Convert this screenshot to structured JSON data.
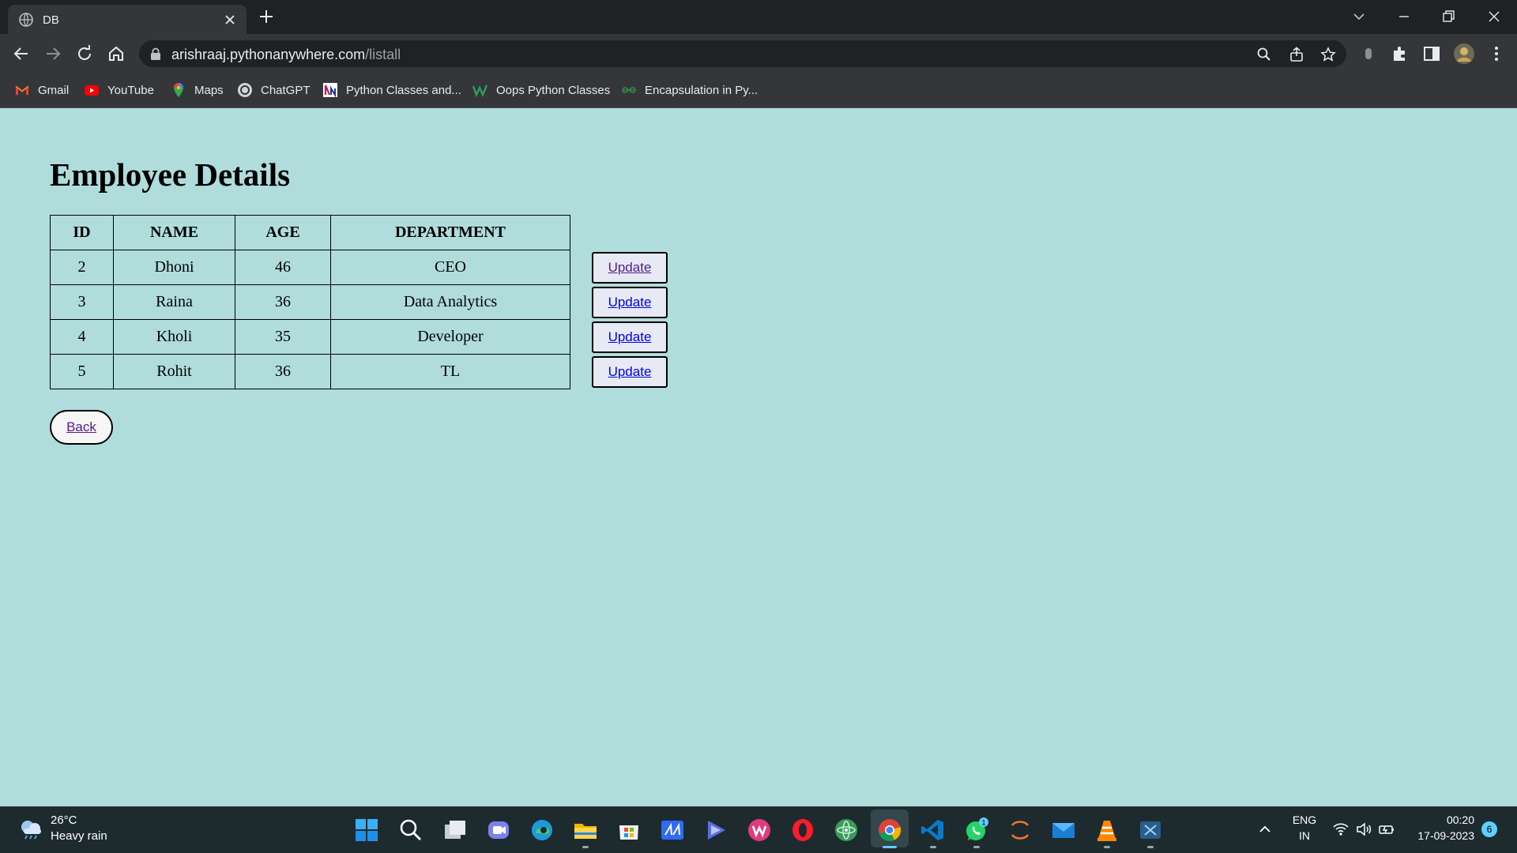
{
  "browser": {
    "tab_title": "DB",
    "url_host": "arishraaj.pythonanywhere.com",
    "url_path": "/listall",
    "bookmarks": [
      {
        "label": "Gmail"
      },
      {
        "label": "YouTube"
      },
      {
        "label": "Maps"
      },
      {
        "label": "ChatGPT"
      },
      {
        "label": "Python Classes and..."
      },
      {
        "label": "Oops Python Classes"
      },
      {
        "label": "Encapsulation in Py..."
      }
    ]
  },
  "page": {
    "title": "Employee Details",
    "table": {
      "headers": [
        "ID",
        "NAME",
        "AGE",
        "DEPARTMENT"
      ],
      "rows": [
        [
          "2",
          "Dhoni",
          "46",
          "CEO"
        ],
        [
          "3",
          "Raina",
          "36",
          "Data Analytics"
        ],
        [
          "4",
          "Kholi",
          "35",
          "Developer"
        ],
        [
          "5",
          "Rohit",
          "36",
          "TL"
        ]
      ]
    },
    "update_label": "Update",
    "back_label": "Back",
    "background_color": "#b0dcdc"
  },
  "taskbar": {
    "weather_temp": "26°C",
    "weather_condition": "Heavy rain",
    "language_line1": "ENG",
    "language_line2": "IN",
    "time": "00:20",
    "date": "17-09-2023",
    "notification_count": "6",
    "whatsapp_badge": "1"
  }
}
